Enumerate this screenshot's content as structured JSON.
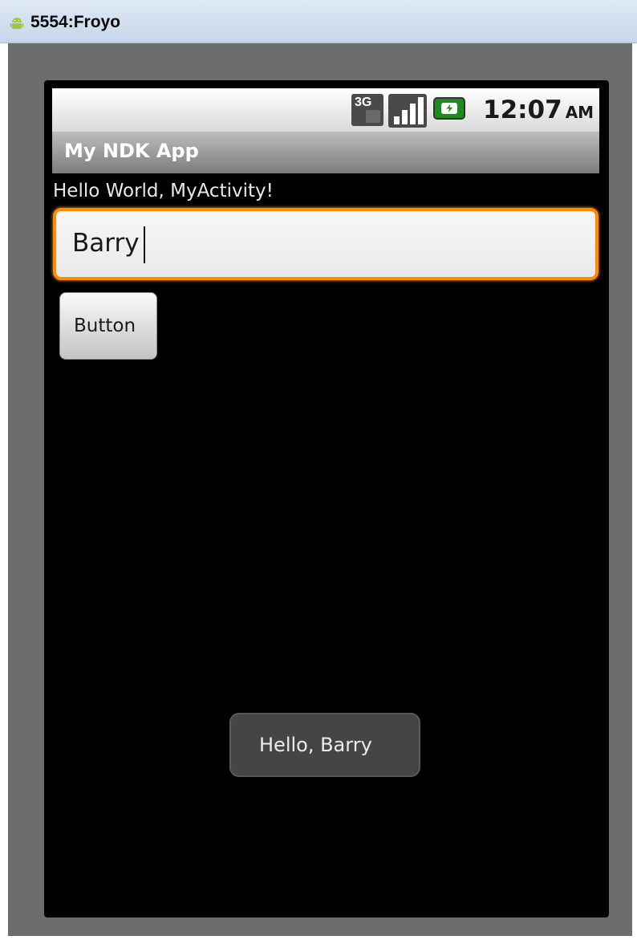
{
  "window": {
    "title": "5554:Froyo",
    "icon": "android-robot-icon"
  },
  "status_bar": {
    "network_label": "3G",
    "time": "12:07",
    "ampm": "AM",
    "icons": [
      "network-3g-icon",
      "signal-strength-icon",
      "battery-charging-icon"
    ]
  },
  "app": {
    "title": "My NDK App",
    "hello_text": "Hello World, MyActivity!",
    "input": {
      "value": "Barry"
    },
    "button_label": "Button",
    "toast_text": "Hello, Barry"
  },
  "colors": {
    "focus_border": "#ff8a00",
    "screen_background": "#000000",
    "skin_background": "#6d6d6d",
    "battery": "#1f8a20"
  }
}
